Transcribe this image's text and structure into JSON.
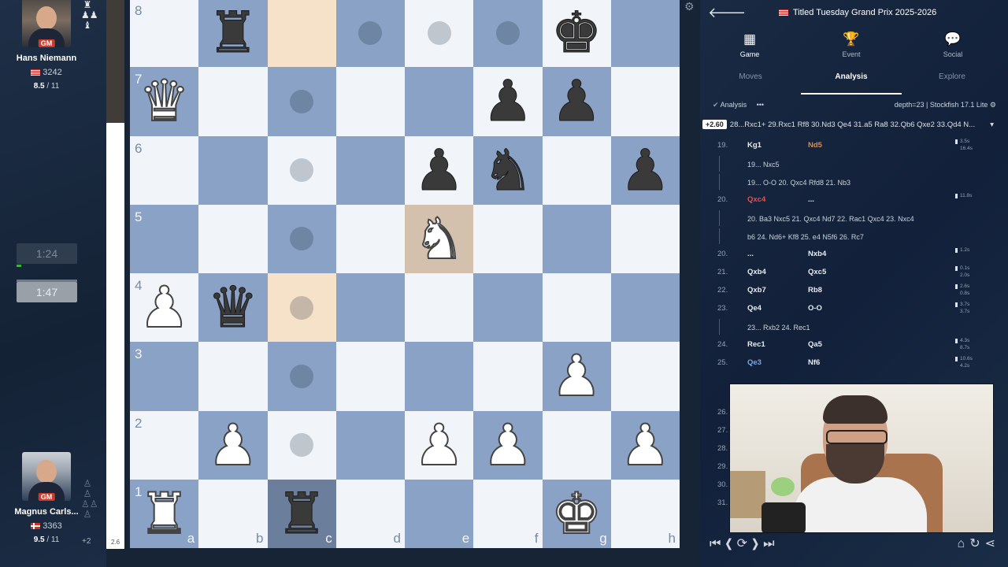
{
  "players": {
    "top": {
      "name": "Hans Niemann",
      "title": "GM",
      "rating": "3242",
      "score": "8.5",
      "rounds": "/ 11",
      "clock": "1:24"
    },
    "bottom": {
      "name": "Magnus Carls...",
      "title": "GM",
      "rating": "3363",
      "score": "9.5",
      "rounds": "/ 11",
      "clock": "1:47",
      "captured_extra": "+2"
    }
  },
  "eval_bar": {
    "value": "2.6"
  },
  "board": {
    "ranks": [
      "8",
      "7",
      "6",
      "5",
      "4",
      "3",
      "2",
      "1"
    ],
    "files": [
      "a",
      "b",
      "c",
      "d",
      "e",
      "f",
      "g",
      "h"
    ],
    "pieces": [
      {
        "sq": "b8",
        "p": "♜",
        "c": "b"
      },
      {
        "sq": "g8",
        "p": "♚",
        "c": "b"
      },
      {
        "sq": "a7",
        "p": "♛",
        "c": "w"
      },
      {
        "sq": "f7",
        "p": "♟",
        "c": "b"
      },
      {
        "sq": "g7",
        "p": "♟",
        "c": "b"
      },
      {
        "sq": "e6",
        "p": "♟",
        "c": "b"
      },
      {
        "sq": "f6",
        "p": "♞",
        "c": "b"
      },
      {
        "sq": "h6",
        "p": "♟",
        "c": "b"
      },
      {
        "sq": "e5",
        "p": "♞",
        "c": "w"
      },
      {
        "sq": "a4",
        "p": "♟",
        "c": "w"
      },
      {
        "sq": "b4",
        "p": "♛",
        "c": "b"
      },
      {
        "sq": "g3",
        "p": "♟",
        "c": "w"
      },
      {
        "sq": "b2",
        "p": "♟",
        "c": "w"
      },
      {
        "sq": "e2",
        "p": "♟",
        "c": "w"
      },
      {
        "sq": "f2",
        "p": "♟",
        "c": "w"
      },
      {
        "sq": "h2",
        "p": "♟",
        "c": "w"
      },
      {
        "sq": "a1",
        "p": "♜",
        "c": "w"
      },
      {
        "sq": "c1",
        "p": "♜",
        "c": "b"
      },
      {
        "sq": "g1",
        "p": "♚",
        "c": "w"
      }
    ],
    "highlights": [
      {
        "sq": "c8",
        "kind": "light"
      },
      {
        "sq": "c4",
        "kind": "light"
      },
      {
        "sq": "e5",
        "kind": "dark"
      },
      {
        "sq": "c1",
        "kind": "c1"
      }
    ],
    "dots": [
      "d8",
      "e8",
      "f8",
      "c7",
      "c6",
      "c5",
      "c4",
      "c3",
      "c2"
    ]
  },
  "header": {
    "title": "Titled Tuesday Grand Prix 2025-2026"
  },
  "main_tabs": [
    {
      "label": "Game",
      "icon": "▦",
      "active": true
    },
    {
      "label": "Event",
      "icon": "🏆",
      "active": false
    },
    {
      "label": "Social",
      "icon": "💬",
      "active": false
    }
  ],
  "sub_tabs": [
    {
      "label": "Moves",
      "active": false
    },
    {
      "label": "Analysis",
      "active": true
    },
    {
      "label": "Explore",
      "active": false
    }
  ],
  "analysis": {
    "label": "Analysis",
    "engine_info": "depth=23 | Stockfish 17.1 Lite",
    "eval": "+2.60",
    "line": "28...Rxc1+ 29.Rxc1 Rf8 30.Nd3 Qe4 31.a5 Ra8 32.Qb6 Qxe2 33.Qd4 N..."
  },
  "moves": [
    {
      "num": "19.",
      "white": "Kg1",
      "black": "Nd5",
      "black_color": "orange",
      "time1": "3.5s",
      "time2": "16.4s"
    },
    {
      "variation": "19... Nxc5"
    },
    {
      "variation": "19... O-O  20. Qxc4  Rfd8  21. Nb3"
    },
    {
      "num": "20.",
      "white": "Qxc4",
      "white_color": "red",
      "black": "...",
      "time1": "11.8s"
    },
    {
      "variation": "20. Ba3  Nxc5  21. Qxc4  Nd7  22. Rac1  Qxc4  23. Nxc4"
    },
    {
      "variation": "b6  24. Nd6+  Kf8  25. e4  N5f6  26. Rc7"
    },
    {
      "num": "20.",
      "white": "...",
      "black": "Nxb4",
      "time1": "1.2s"
    },
    {
      "num": "21.",
      "white": "Qxb4",
      "black": "Qxc5",
      "time1": "0.1s",
      "time2": "2.0s"
    },
    {
      "num": "22.",
      "white": "Qxb7",
      "black": "Rb8",
      "time1": "2.6s",
      "time2": "0.8s"
    },
    {
      "num": "23.",
      "white": "Qe4",
      "black": "O-O",
      "time1": "3.7s",
      "time2": "3.7s"
    },
    {
      "variation": "23... Rxb2  24. Rec1"
    },
    {
      "num": "24.",
      "white": "Rec1",
      "black": "Qa5",
      "time1": "4.3s",
      "time2": "8.7s"
    },
    {
      "num": "25.",
      "white": "Qe3",
      "white_color": "blue",
      "black": "Nf6",
      "time1": "10.6s",
      "time2": "4.2s"
    }
  ],
  "hidden_move_nums": [
    "26.",
    "27.",
    "28.",
    "29.",
    "30.",
    "31."
  ]
}
